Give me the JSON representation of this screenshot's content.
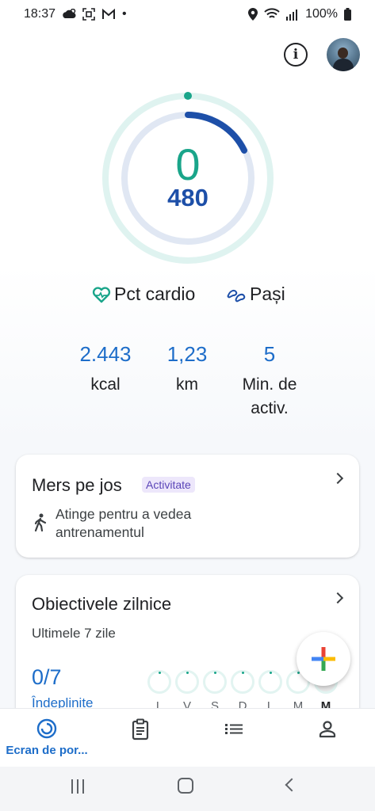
{
  "status_bar": {
    "time": "18:37",
    "dot": "•",
    "battery": "100%",
    "icons": [
      "weather-icon",
      "screenshot-icon",
      "gmail-icon",
      "location-icon",
      "wifi-icon",
      "signal-icon",
      "battery-icon"
    ]
  },
  "header": {
    "info_icon_glyph": "i"
  },
  "ring": {
    "cardio_value": "0",
    "steps_value": "480",
    "colors": {
      "cardio": "#1aa58a",
      "steps": "#1d4fa8"
    }
  },
  "legend": {
    "cardio_label": "Pct cardio",
    "steps_label": "Pași"
  },
  "stats": [
    {
      "value": "2.443",
      "label": "kcal"
    },
    {
      "value": "1,23",
      "label": "km"
    },
    {
      "value": "5",
      "label_line1": "Min. de",
      "label_line2": "activ."
    }
  ],
  "activity_card": {
    "title": "Mers pe jos",
    "badge": "Activitate",
    "hint_line1": "Atinge pentru a vedea",
    "hint_line2": "antrenamentul"
  },
  "goals_card": {
    "title": "Obiectivele zilnice",
    "subtitle": "Ultimele 7 zile",
    "count": "0/7",
    "completed_label": "Îndeplinite",
    "days": [
      "L",
      "V",
      "S",
      "D",
      "L",
      "M",
      "M"
    ]
  },
  "bottom_nav": {
    "home_label": "Ecran de por..."
  }
}
